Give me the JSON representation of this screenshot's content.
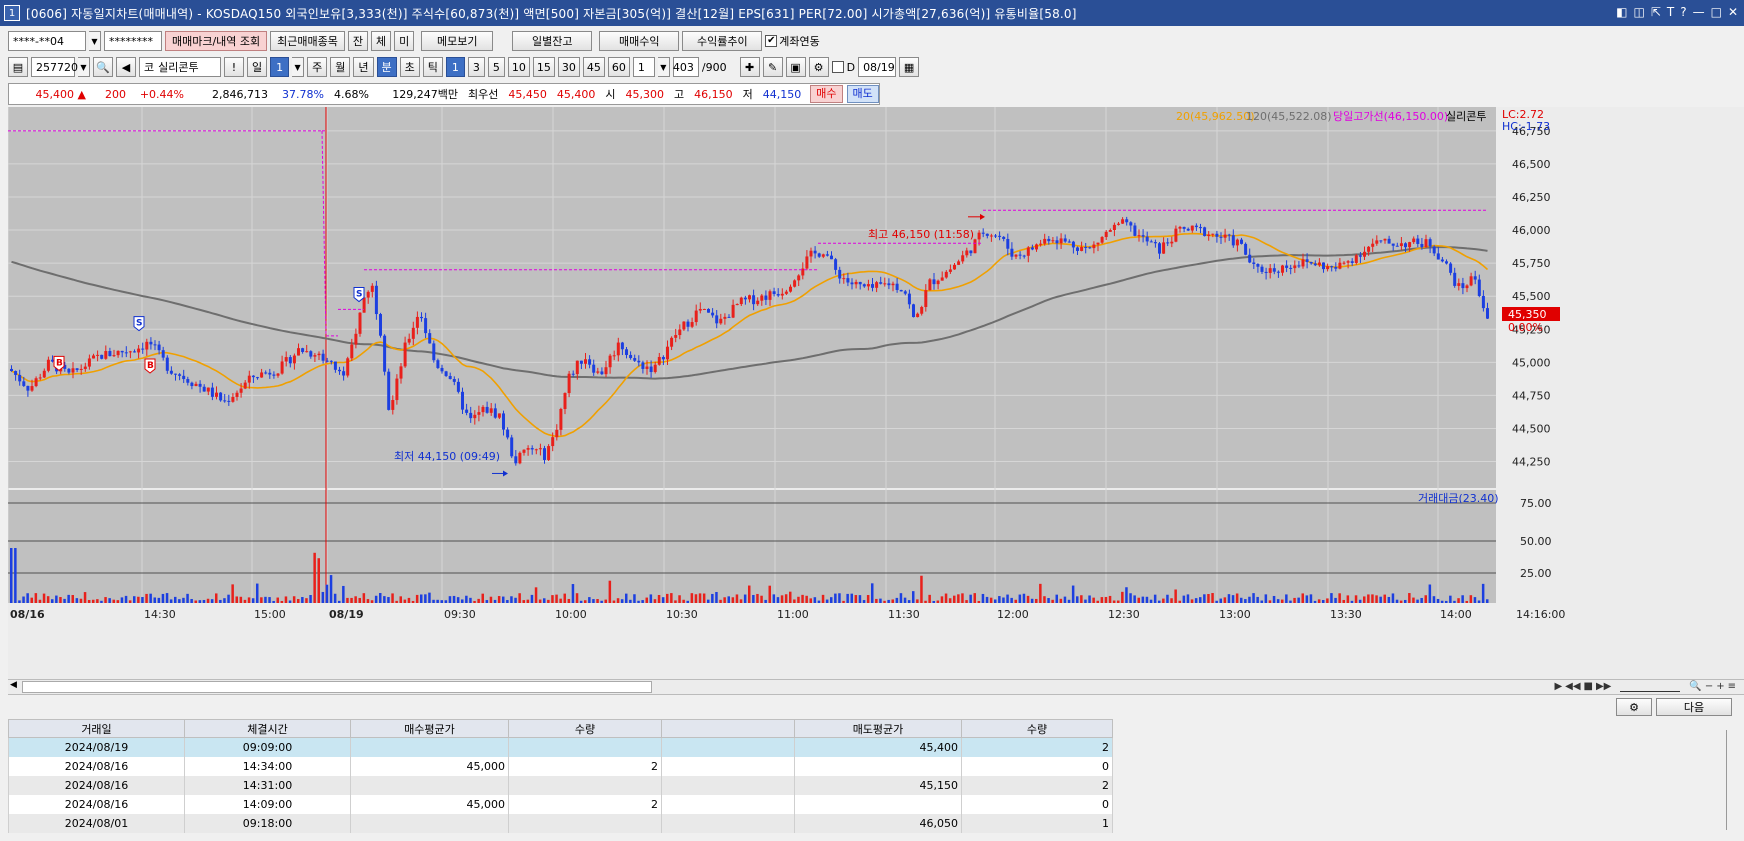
{
  "window": {
    "number": "1",
    "title": "[0606] 자동일지차트(매매내역) - KOSDAQ150 외국인보유[3,333(천)] 주식수[60,873(천)] 액면[500] 자본금[305(억)] 결산[12월] EPS[631] PER[72.00] 시가총액[27,636(억)] 유통비율[58.0]",
    "controls": [
      "◧",
      "◫",
      "⇱",
      "T",
      "?",
      "—",
      "□",
      "✕"
    ]
  },
  "toolbar1": {
    "account": "****-**04",
    "password": "********",
    "mark_btn": "매매마크/내역 조회",
    "recent_btn": "최근매매종목",
    "jan": "잔",
    "che": "체",
    "mi": "미",
    "memo_btn": "메모보기",
    "daily_btn": "일별잔고",
    "profit_btn": "매매수익",
    "rate_btn": "수익률추이",
    "link_label": "계좌연동"
  },
  "toolbar2": {
    "code": "257720",
    "name_prefix": "코",
    "name": "실리콘투",
    "warn": "!",
    "period_day": "일",
    "period_num": "1",
    "week": "주",
    "month": "월",
    "year": "년",
    "min": "분",
    "sec": "초",
    "tick": "틱",
    "intervals": [
      "1",
      "3",
      "5",
      "10",
      "15",
      "30",
      "45",
      "60"
    ],
    "count_val": "1",
    "count": "403",
    "total": "/900",
    "d_label": "D",
    "date": "08/19"
  },
  "quote": {
    "price": "45,400",
    "arrow": "▲",
    "change": "200",
    "change_pct": "+0.44%",
    "volume": "2,846,713",
    "vol_rate": "37.78%",
    "turnover": "4.68%",
    "amount": "129,247백만",
    "best_label": "최우선",
    "ask": "45,450",
    "bid": "45,400",
    "open_label": "시",
    "open": "45,300",
    "high_label": "고",
    "high": "46,150",
    "low_label": "저",
    "low": "44,150",
    "buy_btn": "매수",
    "sell_btn": "매도"
  },
  "chart": {
    "legend": {
      "ma20": "20(45,962.50)",
      "ma120": "120(45,522.08)",
      "highline": "당일고가선(46,150.00)",
      "stock": "실리콘투",
      "lc": "LC:2.72",
      "hc": "HC:-1.73"
    },
    "price_ticks": [
      "46,750",
      "46,500",
      "46,250",
      "46,000",
      "45,750",
      "45,500",
      "45,250",
      "45,000",
      "44,750",
      "44,500",
      "44,250"
    ],
    "cur_price": "45,350",
    "cur_pct": "0.00%",
    "high_note": "최고 46,150 (11:58)",
    "low_note": "최저 44,150 (09:49)",
    "vol_legend": "거래대금(23.40)",
    "vol_ticks": [
      "75.00",
      "50.00",
      "25.00"
    ],
    "time_labels": [
      "08/16",
      "14:30",
      "15:00",
      "08/19",
      "09:30",
      "10:00",
      "10:30",
      "11:00",
      "11:30",
      "12:00",
      "12:30",
      "13:00",
      "13:30",
      "14:00",
      "14:16:00"
    ],
    "marks": [
      {
        "t": "B"
      },
      {
        "t": "S"
      },
      {
        "t": "B"
      },
      {
        "t": "S"
      }
    ],
    "colors": {
      "up": "#e8201b",
      "down": "#1c3fe0",
      "ma20": "#f0a000",
      "ma120": "#6e6e6e",
      "bg": "#c0c0c0",
      "highline": "#e000e0"
    }
  },
  "bottom": {
    "settings_icon": "gear-icon",
    "next_btn": "다음"
  },
  "table": {
    "headers": [
      "거래일",
      "체결시간",
      "매수평균가",
      "수량",
      "",
      "매도평균가",
      "수량"
    ],
    "rows": [
      [
        "2024/08/19",
        "09:09:00",
        "",
        "",
        "",
        "45,400",
        "2"
      ],
      [
        "2024/08/16",
        "14:34:00",
        "45,000",
        "2",
        "",
        "",
        "0"
      ],
      [
        "2024/08/16",
        "14:31:00",
        "",
        "",
        "",
        "45,150",
        "2"
      ],
      [
        "2024/08/16",
        "14:09:00",
        "45,000",
        "2",
        "",
        "",
        "0"
      ],
      [
        "2024/08/01",
        "09:18:00",
        "",
        "",
        "",
        "46,050",
        "1"
      ]
    ]
  }
}
